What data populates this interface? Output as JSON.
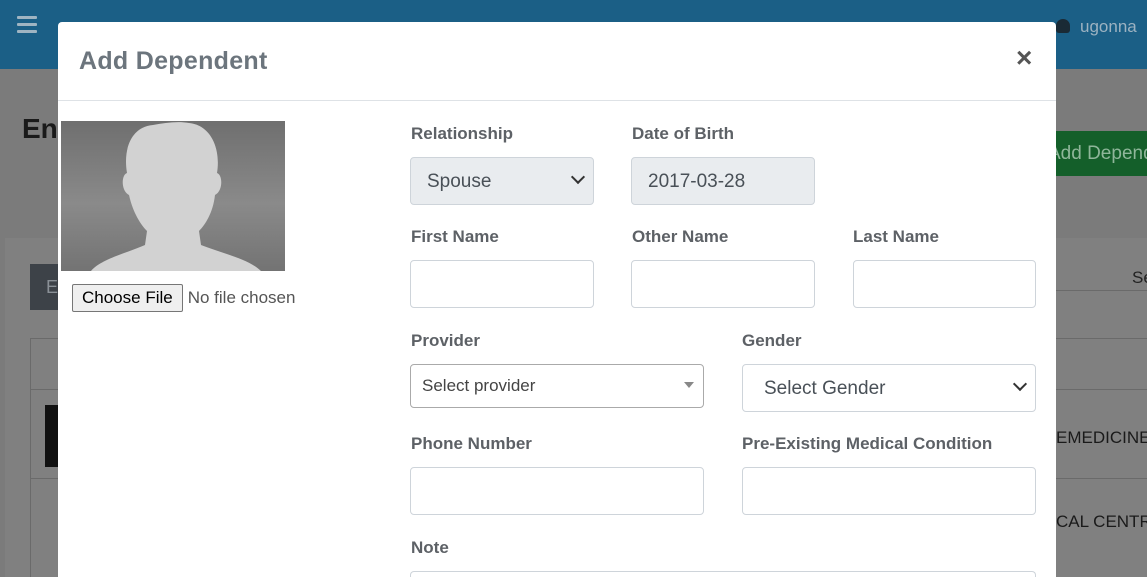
{
  "background": {
    "user_name": "ugonna",
    "page_heading": "En",
    "add_button_label": "Add Depend",
    "tab_label": "E",
    "search_label": "Se",
    "row1_text": "EMEDICINE",
    "row2_text": "CAL CENTR"
  },
  "modal": {
    "title": "Add Dependent",
    "close_label": "×",
    "file_input": {
      "button_label": "Choose File",
      "status": "No file chosen"
    },
    "fields": {
      "relationship": {
        "label": "Relationship",
        "value": "Spouse"
      },
      "date_of_birth": {
        "label": "Date of Birth",
        "value": "2017-03-28"
      },
      "first_name": {
        "label": "First Name",
        "value": ""
      },
      "other_name": {
        "label": "Other Name",
        "value": ""
      },
      "last_name": {
        "label": "Last Name",
        "value": ""
      },
      "provider": {
        "label": "Provider",
        "value": "Select provider"
      },
      "gender": {
        "label": "Gender",
        "value": "Select Gender"
      },
      "phone_number": {
        "label": "Phone Number",
        "value": ""
      },
      "medical_condition": {
        "label": "Pre-Existing Medical Condition",
        "value": ""
      },
      "note": {
        "label": "Note",
        "value": ""
      }
    }
  }
}
